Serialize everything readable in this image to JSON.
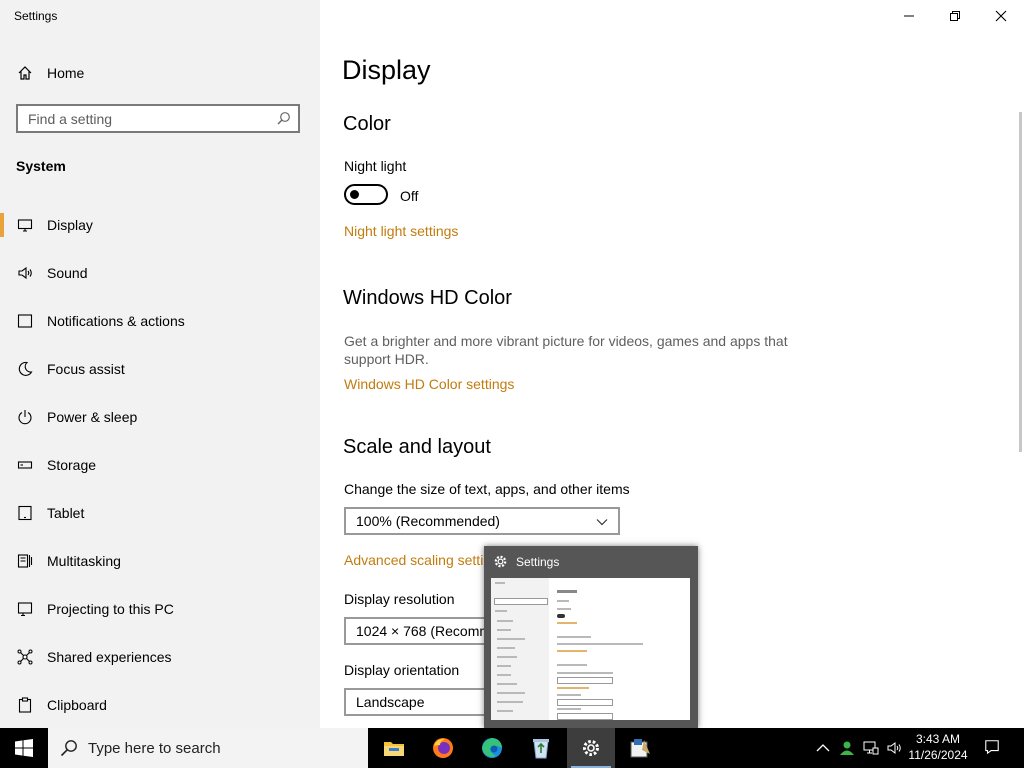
{
  "app": {
    "title": "Settings"
  },
  "sidebar": {
    "home_label": "Home",
    "search_placeholder": "Find a setting",
    "section": "System",
    "items": [
      {
        "label": "Display",
        "icon": "monitor-icon",
        "active": true
      },
      {
        "label": "Sound",
        "icon": "speaker-icon"
      },
      {
        "label": "Notifications & actions",
        "icon": "notification-icon"
      },
      {
        "label": "Focus assist",
        "icon": "moon-icon"
      },
      {
        "label": "Power & sleep",
        "icon": "power-icon"
      },
      {
        "label": "Storage",
        "icon": "storage-icon"
      },
      {
        "label": "Tablet",
        "icon": "tablet-icon"
      },
      {
        "label": "Multitasking",
        "icon": "multitasking-icon"
      },
      {
        "label": "Projecting to this PC",
        "icon": "projector-icon"
      },
      {
        "label": "Shared experiences",
        "icon": "shared-icon"
      },
      {
        "label": "Clipboard",
        "icon": "clipboard-icon"
      }
    ]
  },
  "main": {
    "title": "Display",
    "color_heading": "Color",
    "night_light_label": "Night light",
    "night_light_state": "Off",
    "night_light_link": "Night light settings",
    "hdr_heading": "Windows HD Color",
    "hdr_desc": "Get a brighter and more vibrant picture for videos, games and apps that support HDR.",
    "hdr_link": "Windows HD Color settings",
    "scale_heading": "Scale and layout",
    "scale_label": "Change the size of text, apps, and other items",
    "scale_value": "100% (Recommended)",
    "advanced_link": "Advanced scaling settings",
    "resolution_label": "Display resolution",
    "resolution_value": "1024 × 768 (Recommended)",
    "orientation_label": "Display orientation",
    "orientation_value": "Landscape"
  },
  "thumbnail": {
    "title": "Settings"
  },
  "taskbar": {
    "search_placeholder": "Type here to search",
    "apps": [
      "file-explorer-icon",
      "firefox-icon",
      "edge-icon",
      "recycle-icon",
      "settings-icon",
      "installer-icon"
    ],
    "time": "3:43 AM",
    "date": "11/26/2024"
  },
  "colors": {
    "accent": "#e8a33d",
    "link": "#c27c0e",
    "sidebar_bg": "#f2f2f2"
  }
}
